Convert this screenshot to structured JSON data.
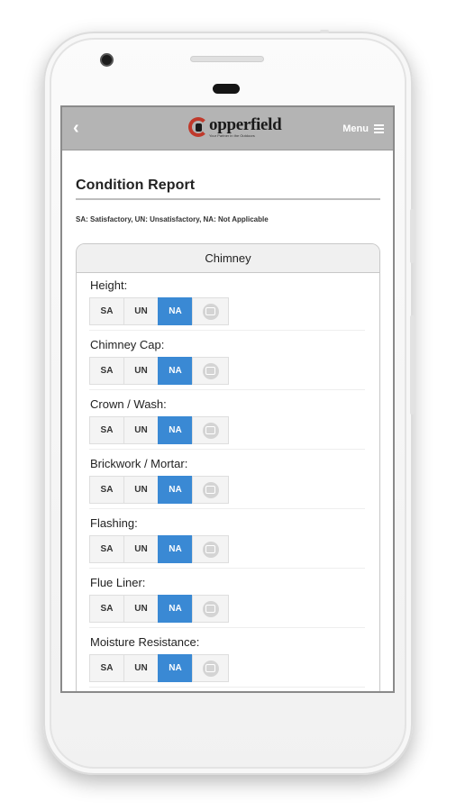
{
  "header": {
    "back_icon": "chevron-left-icon",
    "logo_text": "opperfield",
    "logo_tagline": "Your Partner in the Outdoors",
    "menu_label": "Menu",
    "menu_icon": "hamburger-icon"
  },
  "page": {
    "title": "Condition Report",
    "legend": "SA: Satisfactory, UN: Unsatisfactory, NA: Not Applicable"
  },
  "section": {
    "title": "Chimney",
    "options": [
      "SA",
      "UN",
      "NA"
    ],
    "items": [
      {
        "label": "Height:",
        "selected": "NA"
      },
      {
        "label": "Chimney Cap:",
        "selected": "NA"
      },
      {
        "label": "Crown / Wash:",
        "selected": "NA"
      },
      {
        "label": "Brickwork / Mortar:",
        "selected": "NA"
      },
      {
        "label": "Flashing:",
        "selected": "NA"
      },
      {
        "label": "Flue Liner:",
        "selected": "NA"
      },
      {
        "label": "Moisture Resistance:",
        "selected": "NA"
      }
    ]
  },
  "colors": {
    "accent": "#3a89d4",
    "topbar": "#b4b4b4",
    "logo_red": "#c0392b"
  }
}
